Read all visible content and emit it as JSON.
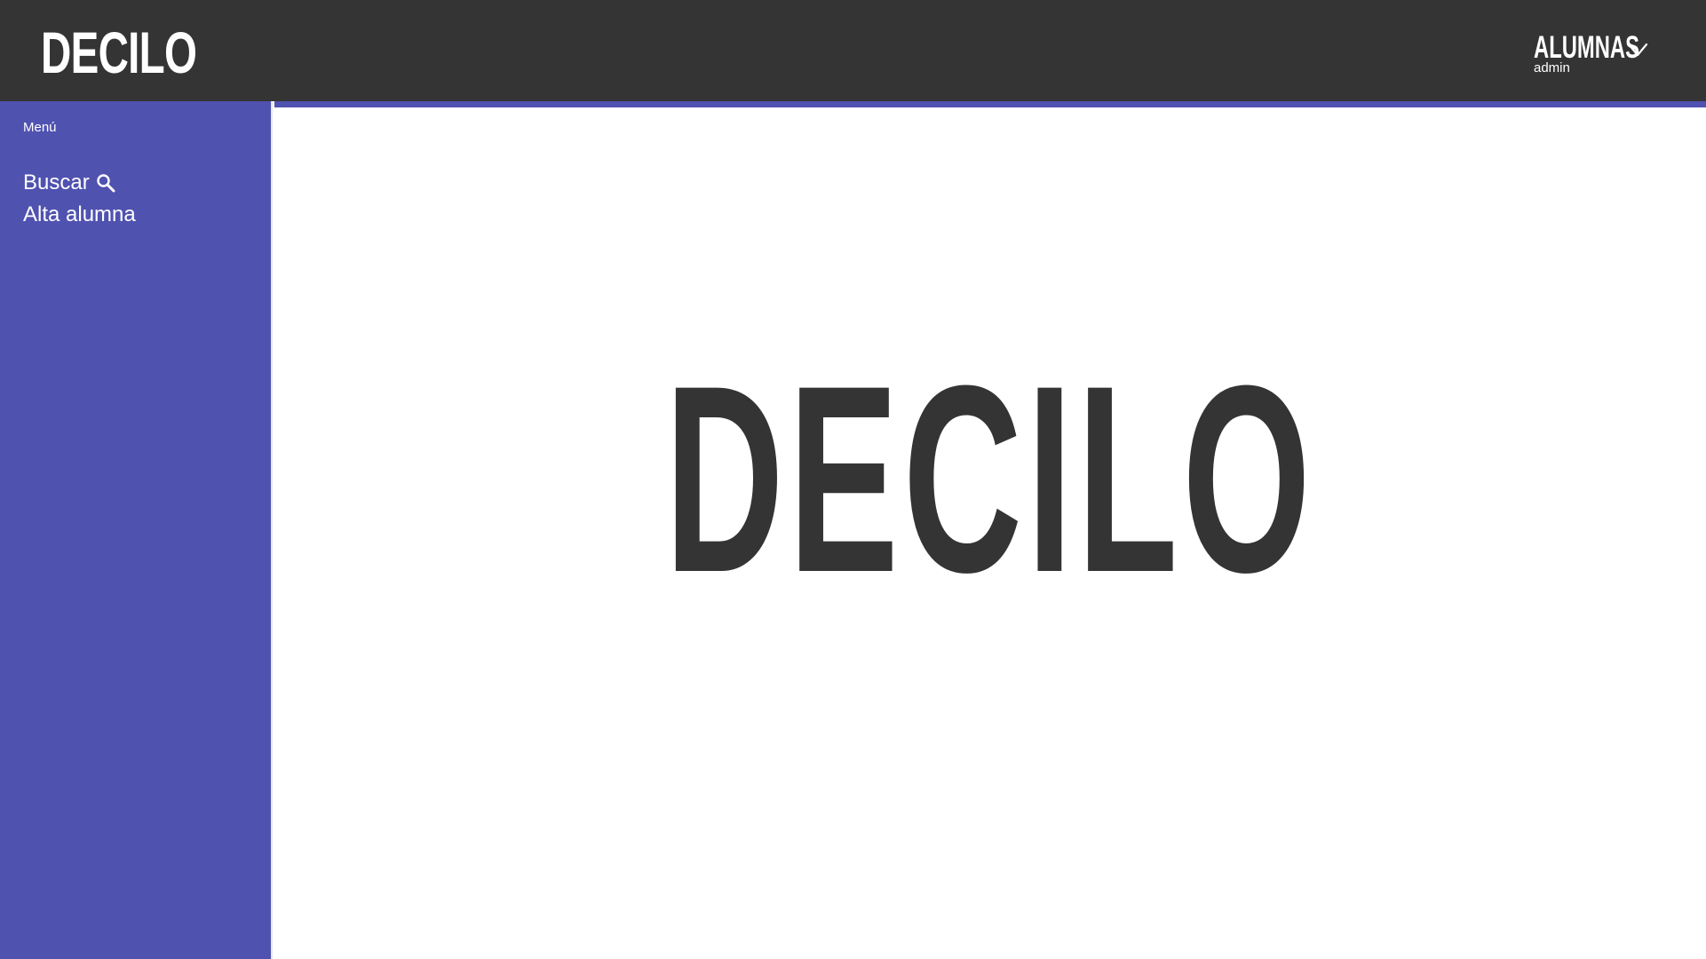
{
  "header": {
    "logo": "DECILO",
    "section_menu": "ALUMNAS",
    "user": "admin",
    "chevron_icon": "chevron-down-icon"
  },
  "sidebar": {
    "title": "Menú",
    "items": [
      {
        "label": "Buscar",
        "icon": "search-icon"
      },
      {
        "label": "Alta alumna"
      }
    ]
  },
  "main": {
    "hero_text": "DECILO"
  },
  "colors": {
    "header_bg": "#343434",
    "accent": "#5052b0",
    "text_dark": "#343434",
    "text_light": "#ffffff"
  }
}
